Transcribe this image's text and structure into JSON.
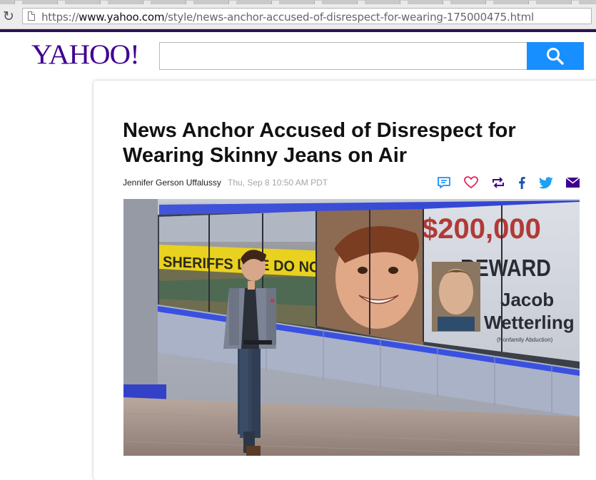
{
  "browser": {
    "url_scheme": "https://",
    "url_host": "www.yahoo.com",
    "url_path": "/style/news-anchor-accused-of-disrespect-for-wearing-175000475.html"
  },
  "header": {
    "logo_text": "YAHOO!",
    "search_value": ""
  },
  "article": {
    "headline": "News Anchor Accused of Disrespect for Wearing Skinny Jeans on Air",
    "author": "Jennifer Gerson Uffalussy",
    "timestamp": "Thu, Sep 8 10:50 AM PDT",
    "share_icons": [
      "comment-icon",
      "heart-icon",
      "retweet-icon",
      "facebook-icon",
      "twitter-icon",
      "mail-icon"
    ]
  },
  "hero": {
    "caution_tape_text": "SHERIFFS LINE DO NOT",
    "poster_amount": "$200,000",
    "poster_reward": "REWARD",
    "poster_first_name": "Jacob",
    "poster_last_name": "Wetterling",
    "poster_subtext": "(Nonfamily Abduction)"
  },
  "colors": {
    "yahoo_purple": "#400090",
    "search_blue": "#188fff",
    "share_icon_blue": "#188fff",
    "share_icon_red": "#e0245e",
    "share_icon_purple": "#400090"
  }
}
